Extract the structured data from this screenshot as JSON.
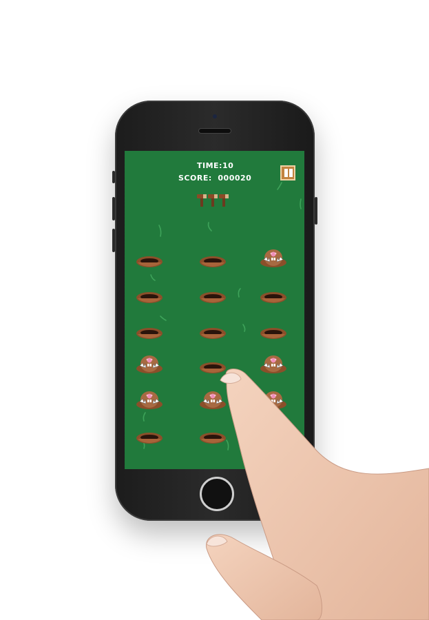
{
  "hud": {
    "time_label": "TIME:",
    "time_value": "10",
    "score_label": "SCORE:",
    "score_value": "000020"
  },
  "pause_button": {
    "icon": "pause-icon",
    "color": "#c2833f"
  },
  "lives": {
    "hammers_remaining": 3,
    "icon": "hammer-icon"
  },
  "board": {
    "background": "#217a3c",
    "rows": 6,
    "cols": 3,
    "cells": [
      [
        "hole",
        "hole",
        "mole"
      ],
      [
        "hole",
        "hole",
        "hole"
      ],
      [
        "hole",
        "hole",
        "hole"
      ],
      [
        "mole",
        "hole",
        "mole"
      ],
      [
        "mole",
        "mole",
        "mole"
      ],
      [
        "hole",
        "hole",
        "hole"
      ]
    ]
  }
}
